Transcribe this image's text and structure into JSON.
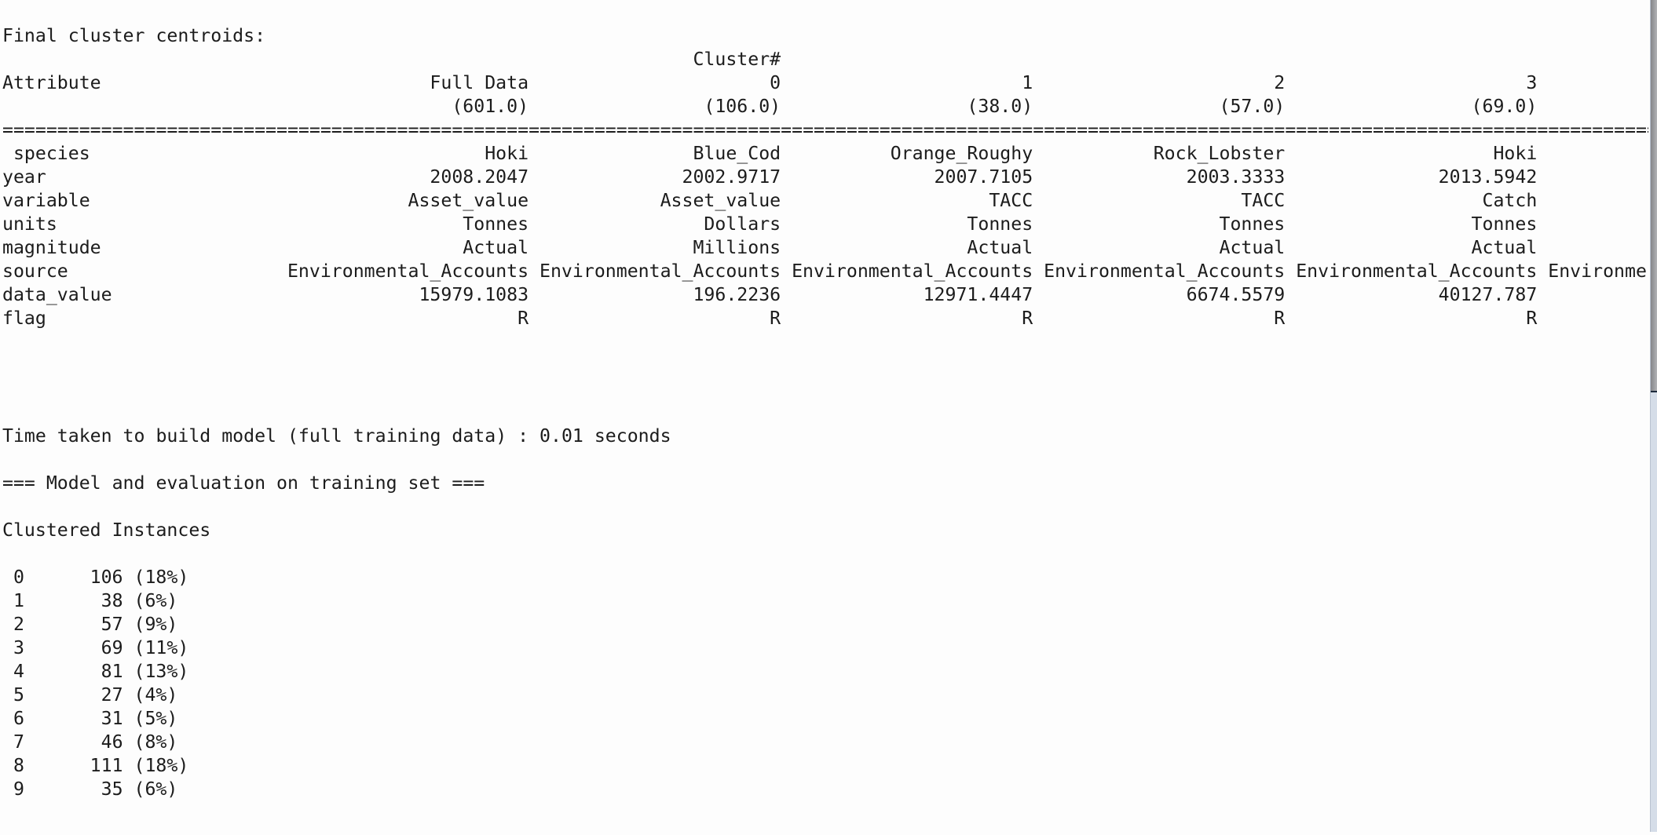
{
  "title": "Final cluster centroids:",
  "cluster_header": "Cluster#",
  "attribute_header": "Attribute",
  "columns": [
    {
      "label": "Full Data",
      "count": "(601.0)"
    },
    {
      "label": "0",
      "count": "(106.0)"
    },
    {
      "label": "1",
      "count": "(38.0)"
    },
    {
      "label": "2",
      "count": "(57.0)"
    },
    {
      "label": "3",
      "count": "(69.0)"
    }
  ],
  "separator": "==========================================================================================================================================================",
  "rows": [
    {
      "attr": " species",
      "values": [
        "Hoki",
        "Blue_Cod",
        "Orange_Roughy",
        "Rock_Lobster",
        "Hoki"
      ],
      "extra": ""
    },
    {
      "attr": "year",
      "values": [
        "2008.2047",
        "2002.9717",
        "2007.7105",
        "2003.3333",
        "2013.5942"
      ],
      "extra": ""
    },
    {
      "attr": "variable",
      "values": [
        "Asset_value",
        "Asset_value",
        "TACC",
        "TACC",
        "Catch"
      ],
      "extra": ""
    },
    {
      "attr": "units",
      "values": [
        "Tonnes",
        "Dollars",
        "Tonnes",
        "Tonnes",
        "Tonnes"
      ],
      "extra": ""
    },
    {
      "attr": "magnitude",
      "values": [
        "Actual",
        "Millions",
        "Actual",
        "Actual",
        "Actual"
      ],
      "extra": ""
    },
    {
      "attr": "source",
      "values": [
        "Environmental_Accounts",
        "Environmental_Accounts",
        "Environmental_Accounts",
        "Environmental_Accounts",
        "Environmental_Accounts"
      ],
      "extra": "Environme"
    },
    {
      "attr": "data_value",
      "values": [
        "15979.1083",
        "196.2236",
        "12971.4447",
        "6674.5579",
        "40127.787"
      ],
      "extra": ""
    },
    {
      "attr": "flag",
      "values": [
        "R",
        "R",
        "R",
        "R",
        "R"
      ],
      "extra": ""
    }
  ],
  "time_taken": "Time taken to build model (full training data) : 0.01 seconds",
  "eval_header": "=== Model and evaluation on training set ===",
  "clustered_header": "Clustered Instances",
  "clustered": [
    {
      "idx": "0",
      "count": "106",
      "pct": "18%"
    },
    {
      "idx": "1",
      "count": "38",
      "pct": "6%"
    },
    {
      "idx": "2",
      "count": "57",
      "pct": "9%"
    },
    {
      "idx": "3",
      "count": "69",
      "pct": "11%"
    },
    {
      "idx": "4",
      "count": "81",
      "pct": "13%"
    },
    {
      "idx": "5",
      "count": "27",
      "pct": "4%"
    },
    {
      "idx": "6",
      "count": "31",
      "pct": "5%"
    },
    {
      "idx": "7",
      "count": "46",
      "pct": "8%"
    },
    {
      "idx": "8",
      "count": "111",
      "pct": "18%"
    },
    {
      "idx": "9",
      "count": "35",
      "pct": "6%"
    }
  ],
  "scrollbar": {
    "position_fraction": 0.0,
    "visible_fraction": 0.47
  }
}
